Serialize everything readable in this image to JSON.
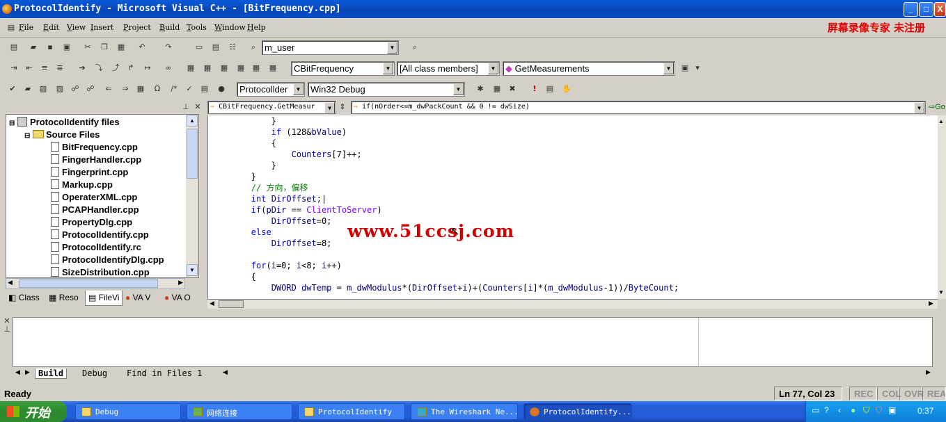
{
  "window": {
    "title": "ProtocolIdentify - Microsoft Visual C++ - [BitFrequency.cpp]",
    "min": "_",
    "max": "□",
    "close": "X"
  },
  "menu": [
    "File",
    "Edit",
    "View",
    "Insert",
    "Project",
    "Build",
    "Tools",
    "Window",
    "Help"
  ],
  "registration_text": "屏幕录像专家  未注册",
  "toolbar": {
    "find_combo": "m_user",
    "class_combo": "CBitFrequency",
    "filter_combo": "[All class members]",
    "member_combo": "GetMeasurements",
    "project_combo": "Protocollder",
    "config_combo": "Win32 Debug"
  },
  "workspace": {
    "root": "ProtocolIdentify files",
    "folder": "Source Files",
    "files": [
      "BitFrequency.cpp",
      "FingerHandler.cpp",
      "Fingerprint.cpp",
      "Markup.cpp",
      "OperaterXML.cpp",
      "PCAPHandler.cpp",
      "PropertyDlg.cpp",
      "ProtocolIdentify.cpp",
      "ProtocolIdentify.rc",
      "ProtocolIdentifyDlg.cpp",
      "SizeDistribution.cpp"
    ],
    "tabs": [
      "Class",
      "Reso",
      "FileVi",
      "VA V",
      "VA O"
    ]
  },
  "editor": {
    "nav_scope": "CBitFrequency.GetMeasur",
    "nav_context": "if(nOrder<=m_dwPackCount && 0 != dwSize)",
    "nav_go": "Go",
    "watermark": "www.51ccsj.com"
  },
  "output": {
    "tabs": [
      "Build",
      "Debug",
      "Find in Files 1"
    ]
  },
  "status": {
    "text": "Ready",
    "position": "Ln 77, Col 23",
    "indicators": [
      "REC",
      "COL",
      "OVR",
      "READ"
    ]
  },
  "taskbar": {
    "start": "开始",
    "tasks": [
      "Debug",
      "网络连接",
      "ProtocolIdentify",
      "The Wireshark Ne...",
      "ProtocolIdentify..."
    ],
    "clock": "0:37"
  },
  "colors": {
    "keyword": "#0000ff",
    "comment": "#008000",
    "watermark": "#d00000"
  }
}
